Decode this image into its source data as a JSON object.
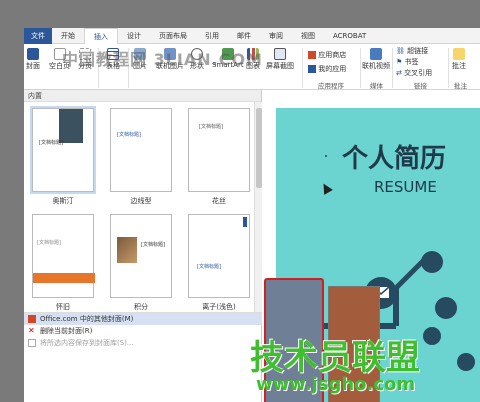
{
  "ribbon_tabs": [
    "文件",
    "开始",
    "插入",
    "设计",
    "页面布局",
    "引用",
    "邮件",
    "审阅",
    "视图",
    "ACROBAT"
  ],
  "ribbon": {
    "cover": "封面",
    "blank": "空白页",
    "page_break": "分页",
    "table": "表格",
    "picture": "图片",
    "online_picture": "联机图片",
    "shapes": "形状",
    "smartart": "SmartArt",
    "chart": "图表",
    "screenshot": "屏幕截图",
    "app_store": "应用商店",
    "my_apps": "我的应用",
    "online_video": "联机视频",
    "hyperlink": "超链接",
    "bookmark": "书签",
    "cross_ref": "交叉引用",
    "comment": "批注",
    "group_apps": "应用程序",
    "group_media": "媒体",
    "group_links": "链接",
    "group_comments": "批注"
  },
  "gallery": {
    "header": "内置",
    "items": [
      {
        "label": "奥斯汀"
      },
      {
        "label": "边线型"
      },
      {
        "label": "花丝"
      },
      {
        "label": "怀旧"
      },
      {
        "label": "积分"
      },
      {
        "label": "离子(浅色)"
      }
    ],
    "thumb_title": "[文档标题]",
    "menu": [
      {
        "label": "Office.com 中的其他封面(M)"
      },
      {
        "label": "删除当前封面(R)"
      },
      {
        "label": "将所选内容保存到封面库(S)..."
      }
    ]
  },
  "document": {
    "title": "个人简历",
    "subtitle": "RESUME"
  },
  "watermarks": {
    "top": "中国教程网 3LIAN.COM",
    "logo": "技术员联盟",
    "url": "www.jsgho.com"
  },
  "colors": {
    "accent": "#2b579a",
    "doc_bg": "#6bd3d0",
    "icon_navy": "#264a60",
    "watermark_green": "#3fbf2f"
  }
}
